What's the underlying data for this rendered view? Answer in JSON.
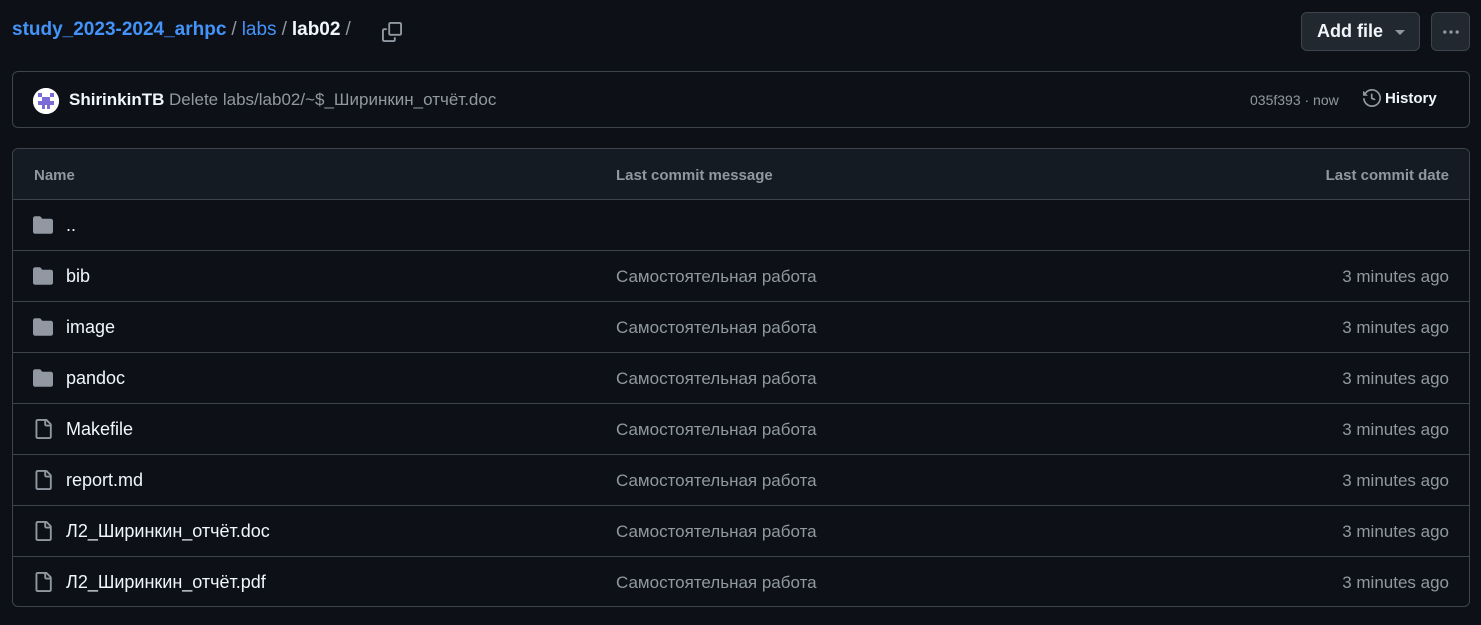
{
  "breadcrumb": {
    "repo": "study_2023-2024_arhpc",
    "folder": "labs",
    "current": "lab02",
    "separator": "/"
  },
  "toolbar": {
    "add_file_label": "Add file",
    "add_file_icon": "triangle-down-icon",
    "more_icon": "kebab-horizontal-icon",
    "copy_icon": "copy-icon"
  },
  "commit": {
    "author": "ShirinkinTB",
    "message": "Delete labs/lab02/~$_Ширинкин_отчёт.doc",
    "sha_time": "035f393 · now",
    "history_label": "History",
    "history_icon": "history-icon"
  },
  "table": {
    "headers": {
      "name": "Name",
      "message": "Last commit message",
      "date": "Last commit date"
    },
    "rows": [
      {
        "type": "directory",
        "name": "..",
        "message": "",
        "date": ""
      },
      {
        "type": "directory",
        "name": "bib",
        "message": "Самостоятельная работа",
        "date": "3 minutes ago"
      },
      {
        "type": "directory",
        "name": "image",
        "message": "Самостоятельная работа",
        "date": "3 minutes ago"
      },
      {
        "type": "directory",
        "name": "pandoc",
        "message": "Самостоятельная работа",
        "date": "3 minutes ago"
      },
      {
        "type": "file",
        "name": "Makefile",
        "message": "Самостоятельная работа",
        "date": "3 minutes ago"
      },
      {
        "type": "file",
        "name": "report.md",
        "message": "Самостоятельная работа",
        "date": "3 minutes ago"
      },
      {
        "type": "file",
        "name": "Л2_Ширинкин_отчёт.doc",
        "message": "Самостоятельная работа",
        "date": "3 minutes ago"
      },
      {
        "type": "file",
        "name": "Л2_Ширинкин_отчёт.pdf",
        "message": "Самостоятельная работа",
        "date": "3 minutes ago"
      }
    ]
  },
  "colors": {
    "background": "#0d1117",
    "link": "#4493f8",
    "border": "#3d444d",
    "muted": "#9198a1",
    "text": "#f0f6fc",
    "header_bg": "#151b23"
  }
}
